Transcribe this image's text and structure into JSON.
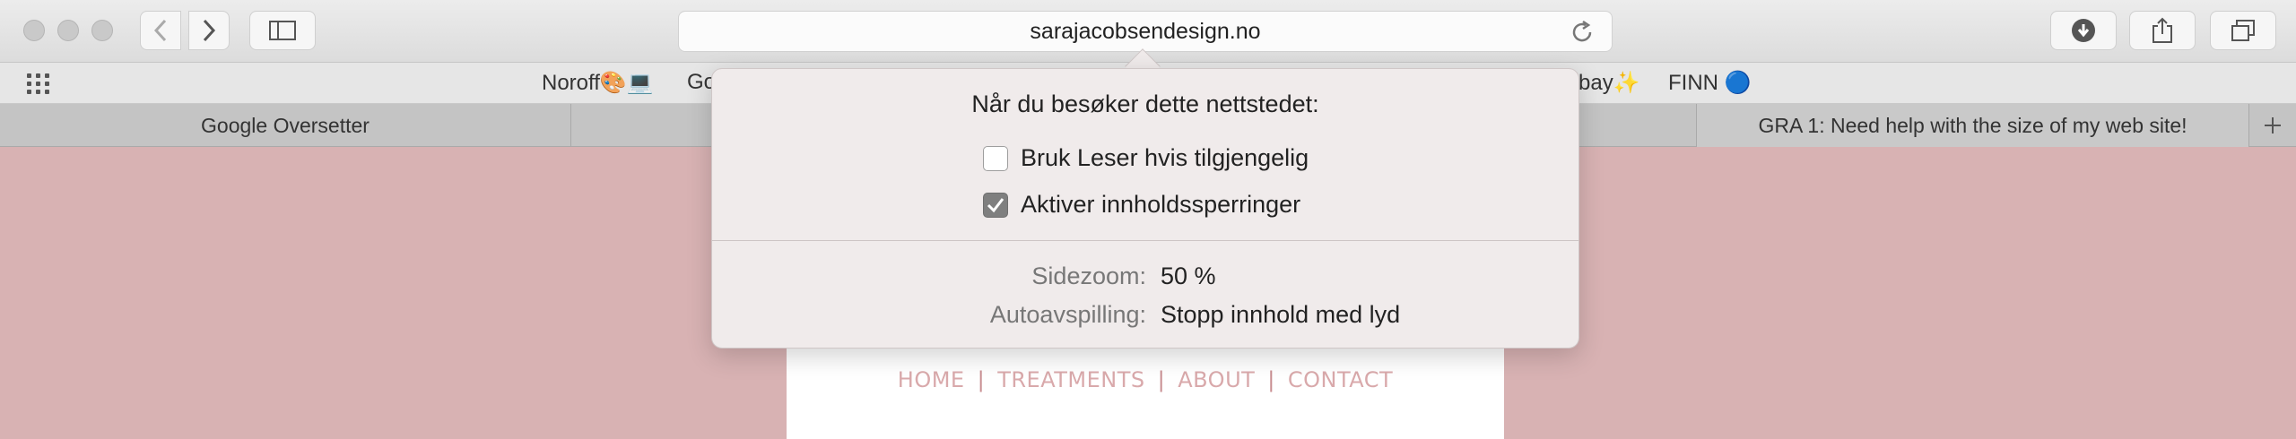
{
  "toolbar": {
    "url": "sarajacobsendesign.no",
    "icons": [
      "back-icon",
      "forward-icon",
      "sidebar-icon",
      "reload-icon",
      "download-icon",
      "share-icon",
      "tabs-overview-icon"
    ]
  },
  "bookmarks": {
    "items": [
      {
        "label": "Noroff🎨💻"
      },
      {
        "label": "Go"
      },
      {
        "label": "bay✨"
      },
      {
        "label": "FINN 🔵"
      }
    ]
  },
  "tabs": [
    {
      "label": "Google Oversetter"
    },
    {
      "label": ""
    },
    {
      "label": ""
    },
    {
      "label": "GRA 1: Need help with the size of my web site!"
    }
  ],
  "page": {
    "nav": [
      "HOME",
      "TREATMENTS",
      "ABOUT",
      "CONTACT"
    ],
    "separator": "|"
  },
  "popover": {
    "title": "Når du besøker dette nettstedet:",
    "options": [
      {
        "label": "Bruk Leser hvis tilgjengelig",
        "checked": false
      },
      {
        "label": "Aktiver innholdssperringer",
        "checked": true
      }
    ],
    "settings": [
      {
        "label": "Sidezoom:",
        "value": "50 %"
      },
      {
        "label": "Autoavspilling:",
        "value": "Stopp innhold med lyd"
      }
    ]
  },
  "colors": {
    "page_background": "#d8b2b3",
    "nav_text": "#d9a9ab"
  }
}
